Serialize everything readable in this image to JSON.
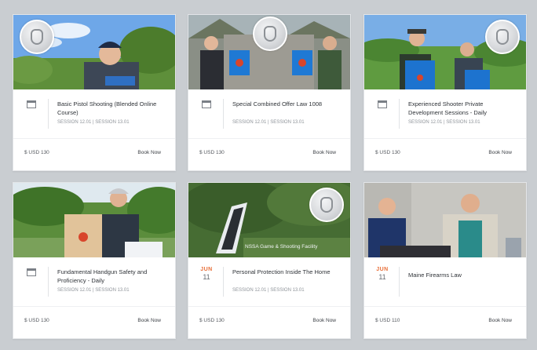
{
  "cards": [
    {
      "title": "Basic Pistol Shooting (Blended Online Course)",
      "meta": "SESSION 12.01 | SESSION 13.01",
      "price": "$ USD 130",
      "book": "Book Now",
      "date": null,
      "photo": "man-shooting-range-sky",
      "badge": "club-logo"
    },
    {
      "title": "Special Combined Offer Law 1008",
      "meta": "SESSION 12.01 | SESSION 13.01",
      "price": "$ USD 130",
      "book": "Book Now",
      "date": null,
      "photo": "two-people-holding-targets",
      "badge": "club-logo"
    },
    {
      "title": "Experienced Shooter Private Development Sessions - Daily",
      "meta": "SESSION 12.01 | SESSION 13.01",
      "price": "$ USD 130",
      "book": "Book Now",
      "date": null,
      "photo": "two-men-with-targets-field",
      "badge": "club-logo"
    },
    {
      "title": "Fundamental Handgun Safety and Proficiency - Daily",
      "meta": "SESSION 12.01 | SESSION 13.01",
      "price": "$ USD 130",
      "book": "Book Now",
      "date": null,
      "photo": "student-holding-certificate",
      "badge": "none"
    },
    {
      "title": "Personal Protection Inside The Home",
      "meta": "SESSION 12.01 | SESSION 13.01",
      "price": "$ USD 130",
      "book": "Book Now",
      "date": {
        "month": "JUN",
        "day": "11"
      },
      "photo": "outdoor-range-sign",
      "caption": "NSSA Game & Shooting Facility",
      "badge": "club-logo"
    },
    {
      "title": "Maine Firearms Law",
      "meta": "",
      "price": "$ USD 110",
      "book": "Book Now",
      "date": {
        "month": "JUN",
        "day": "11"
      },
      "photo": "classroom-instructors",
      "badge": "none"
    }
  ],
  "colors": {
    "background": "#c9cdd1",
    "card": "#ffffff",
    "accent_date": "#e8703a",
    "text": "#2f3338"
  }
}
